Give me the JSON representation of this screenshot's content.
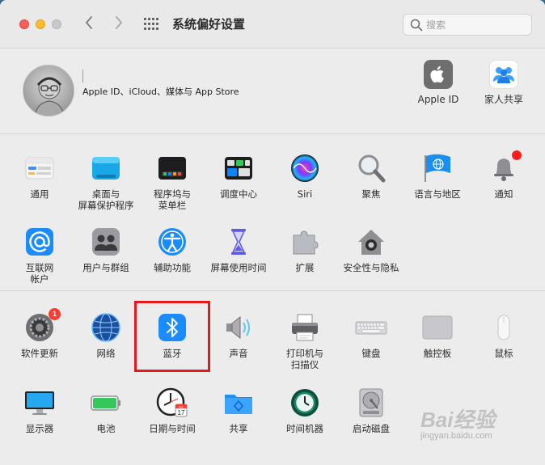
{
  "window": {
    "title": "系统偏好设置",
    "search_placeholder": "搜索"
  },
  "account": {
    "subtitle": "Apple ID、iCloud、媒体与 App Store",
    "apple_id_label": "Apple ID",
    "family_label": "家人共享"
  },
  "row1": [
    {
      "label": "通用"
    },
    {
      "label": "桌面与\n屏幕保护程序"
    },
    {
      "label": "程序坞与\n菜单栏"
    },
    {
      "label": "调度中心"
    },
    {
      "label": "Siri"
    },
    {
      "label": "聚焦"
    },
    {
      "label": "语言与地区"
    },
    {
      "label": "通知"
    }
  ],
  "row2": [
    {
      "label": "互联网\n帐户"
    },
    {
      "label": "用户与群组"
    },
    {
      "label": "辅助功能"
    },
    {
      "label": "屏幕使用时间"
    },
    {
      "label": "扩展"
    },
    {
      "label": "安全性与隐私"
    }
  ],
  "row3": [
    {
      "label": "软件更新",
      "badge": "1"
    },
    {
      "label": "网络"
    },
    {
      "label": "蓝牙"
    },
    {
      "label": "声音"
    },
    {
      "label": "打印机与\n扫描仪"
    },
    {
      "label": "键盘"
    },
    {
      "label": "触控板"
    },
    {
      "label": "鼠标"
    }
  ],
  "row4": [
    {
      "label": "显示器"
    },
    {
      "label": "电池"
    },
    {
      "label": "日期与时间",
      "calendar_month": "JUL",
      "calendar_day": "17"
    },
    {
      "label": "共享"
    },
    {
      "label": "时间机器"
    },
    {
      "label": "启动磁盘"
    }
  ],
  "watermark": {
    "brand": "Bai经验",
    "url": "jingyan.baidu.com"
  },
  "colors": {
    "highlight": "#e5191b",
    "badge": "#ff3b30"
  }
}
